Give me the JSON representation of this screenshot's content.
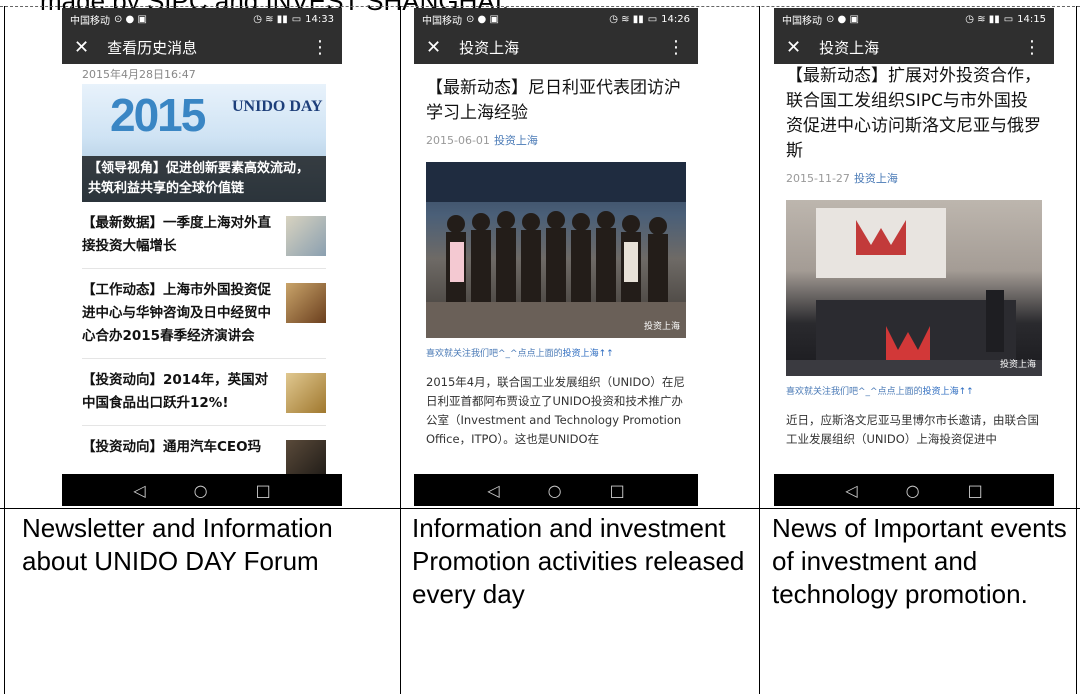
{
  "top_caption": "made by SIPC and INVEST SHANGHAI.",
  "phones": [
    {
      "status": {
        "carrier": "中国移动",
        "time": "14:33"
      },
      "title": "查看历史消息",
      "date": "2015年4月28日16:47",
      "hero": {
        "logo_year": "2015",
        "logo_text": "UNIDO DAY",
        "caption": "【领导视角】促进创新要素高效流动，共筑利益共享的全球价值链"
      },
      "items": [
        {
          "text": "【最新数据】一季度上海对外直接投资大幅增长"
        },
        {
          "text": "【工作动态】上海市外国投资促进中心与华钟咨询及日中经贸中心合办2015春季经济演讲会"
        },
        {
          "text": "【投资动向】2014年，英国对中国食品出口跃升12%!"
        },
        {
          "text": "【投资动向】通用汽车CEO玛"
        }
      ]
    },
    {
      "status": {
        "carrier": "中国移动",
        "time": "14:26"
      },
      "title": "投资上海",
      "article_title": "【最新动态】尼日利亚代表团访沪 学习上海经验",
      "meta_date": "2015-06-01",
      "meta_source": "投资上海",
      "photo_watermark": "投资上海",
      "follow_prefix": "喜欢就关注我们吧^_^点点上面的",
      "follow_link": "投资上海↑↑",
      "body": "2015年4月，联合国工业发展组织（UNIDO）在尼日利亚首都阿布贾设立了UNIDO投资和技术推广办公室（Investment and Technology Promotion Office，ITPO）。这也是UNIDO在"
    },
    {
      "status": {
        "carrier": "中国移动",
        "time": "14:15"
      },
      "title": "投资上海",
      "article_title": "【最新动态】扩展对外投资合作，联合国工发组织SIPC与市外国投资促进中心访问斯洛文尼亚与俄罗斯",
      "meta_date": "2015-11-27",
      "meta_source": "投资上海",
      "photo_watermark": "投资上海",
      "follow_prefix": "喜欢就关注我们吧^_^点点上面的",
      "follow_link": "投资上海↑↑",
      "body": "近日，应斯洛文尼亚马里博尔市长邀请，由联合国工业发展组织（UNIDO）上海投资促进中"
    }
  ],
  "captions": [
    "Newsletter and Information about UNIDO DAY Forum",
    "Information and investment Promotion activities released every day",
    "News of Important events of investment and technology promotion."
  ]
}
